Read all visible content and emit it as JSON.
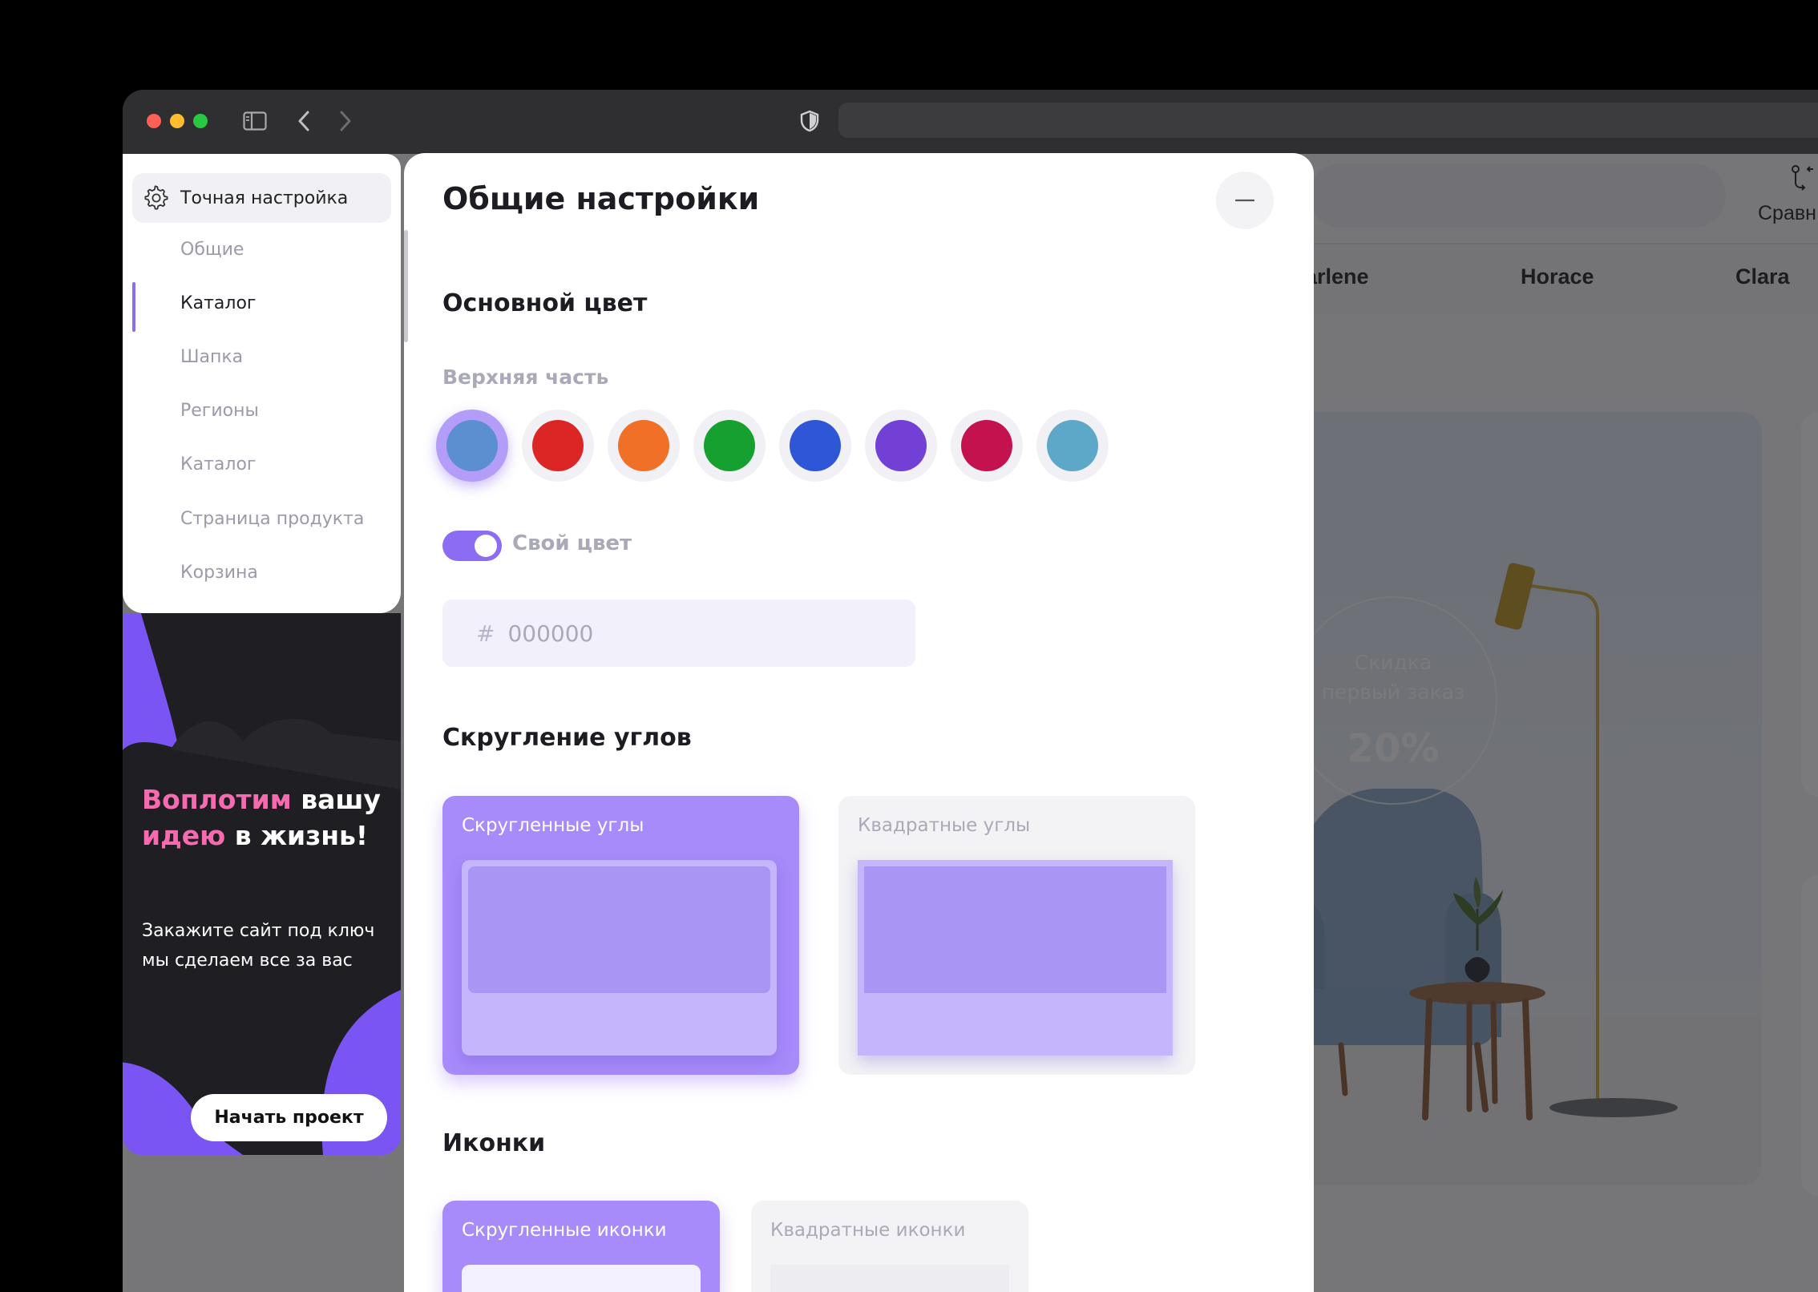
{
  "browser": {
    "address_value": ""
  },
  "site": {
    "compare_label": "Сравн",
    "nav_items": [
      "arlene",
      "Horace",
      "Clara"
    ],
    "promo": {
      "line1": "Скидка",
      "line2": "первый заказ",
      "value": "20%"
    }
  },
  "tuning_menu": {
    "title": "Точная настройка",
    "items": [
      {
        "label": "Общие"
      },
      {
        "label": "Каталог",
        "active": true
      },
      {
        "label": "Шапка"
      },
      {
        "label": "Регионы"
      },
      {
        "label": "Каталог"
      },
      {
        "label": "Страница продукта"
      },
      {
        "label": "Корзина"
      }
    ]
  },
  "banner": {
    "title_pink_1": "Воплотим",
    "title_white_1": " вашу",
    "title_pink_2": "идею",
    "title_white_2": " в жизнь!",
    "text": "Закажите сайт под ключ мы сделаем все за вас",
    "cta": "Начать проект"
  },
  "settings": {
    "title": "Общие настройки",
    "primary_color": {
      "title": "Основной цвет",
      "subsection": "Верхняя часть",
      "swatches": [
        "#5b8fcf",
        "#dc2626",
        "#f07028",
        "#16a02f",
        "#2e56d6",
        "#7340d6",
        "#c4124f",
        "#5da7c9"
      ],
      "selected_index": 0,
      "custom_toggle_on": true,
      "custom_label": "Свой цвет",
      "hex_prefix": "#",
      "hex_placeholder": "000000"
    },
    "corners": {
      "title": "Скругление углов",
      "options": [
        {
          "label": "Скругленные углы",
          "selected": true
        },
        {
          "label": "Квадратные углы",
          "selected": false
        }
      ]
    },
    "icons": {
      "title": "Иконки",
      "options": [
        {
          "label": "Скругленные иконки",
          "selected": true
        },
        {
          "label": "Квадратные иконки",
          "selected": false
        }
      ]
    }
  },
  "colors": {
    "accent": "#8b6cf3",
    "accent_light": "#a78bfa",
    "banner_bg": "#7a55f4",
    "banner_pink": "#f66bb0"
  }
}
